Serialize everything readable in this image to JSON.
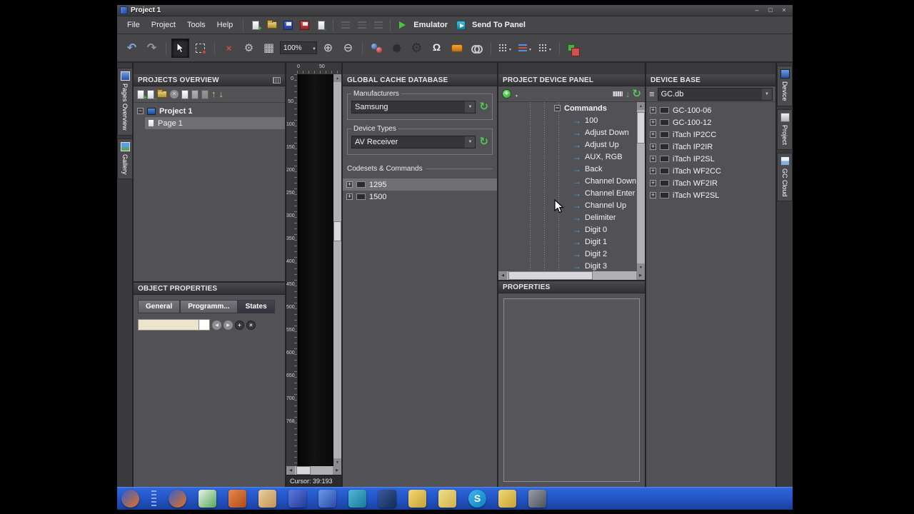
{
  "colors": {
    "taskbar_blue": "#2457c9",
    "panel_bg": "#515156",
    "selection": "#6e6e73",
    "accent_green": "#54c654",
    "command_arrow_blue": "#4aa8e8"
  },
  "titlebar": {
    "title": "Project 1",
    "minimize": "–",
    "maximize": "□",
    "close": "×"
  },
  "menubar": {
    "menus": [
      "File",
      "Project",
      "Tools",
      "Help"
    ],
    "emulator_label": "Emulator",
    "send_to_panel_label": "Send To Panel"
  },
  "toolbar": {
    "zoom": "100%"
  },
  "left_tabs": [
    {
      "label": "Pages Overview"
    },
    {
      "label": "Gallery"
    }
  ],
  "projects_overview": {
    "title": "PROJECTS OVERVIEW",
    "project_name": "Project 1",
    "page_name": "Page 1"
  },
  "object_properties": {
    "title": "OBJECT PROPERTIES",
    "tabs": [
      {
        "label": "General"
      },
      {
        "label": "Programm..."
      },
      {
        "label": "States",
        "selected": true
      }
    ],
    "state_field_value": ""
  },
  "canvas": {
    "hruler": [
      "0",
      "50"
    ],
    "vruler": [
      "0",
      "50",
      "100",
      "150",
      "200",
      "250",
      "300",
      "350",
      "400",
      "450",
      "500",
      "550",
      "600",
      "650",
      "700",
      "768"
    ],
    "status": "Cursor: 39:193"
  },
  "global_cache": {
    "title": "GLOBAL CACHE DATABASE",
    "manufacturers_label": "Manufacturers",
    "manufacturers_value": "Samsung",
    "device_types_label": "Device Types",
    "device_types_value": "AV Receiver",
    "codesets_label": "Codesets & Commands",
    "codesets": [
      {
        "label": "1295",
        "selected": true
      },
      {
        "label": "1500"
      }
    ]
  },
  "project_device_panel": {
    "title": "PROJECT DEVICE PANEL",
    "root_node": "Commands",
    "commands": [
      "100",
      "Adjust Down",
      "Adjust Up",
      "AUX, RGB",
      "Back",
      "Channel Down",
      "Channel Enter",
      "Channel Up",
      "Delimiter",
      "Digit 0",
      "Digit 1",
      "Digit 2",
      "Digit 3"
    ]
  },
  "properties_panel": {
    "title": "PROPERTIES"
  },
  "device_base": {
    "title": "DEVICE BASE",
    "database": "GC.db",
    "devices": [
      "GC-100-06",
      "GC-100-12",
      "iTach IP2CC",
      "iTach IP2IR",
      "iTach IP2SL",
      "iTach WF2CC",
      "iTach WF2IR",
      "iTach WF2SL"
    ]
  },
  "right_tabs": [
    {
      "label": "Device"
    },
    {
      "label": "Project"
    },
    {
      "label": "GC Cloud"
    }
  ],
  "taskbar": {
    "items": [
      {
        "name": "firefox",
        "c1": "#2f5fd0",
        "c2": "#e8701a",
        "cls": "round"
      },
      {
        "name": "grip",
        "cls": "grip"
      },
      {
        "name": "firefox-2",
        "c1": "#2f5fd0",
        "c2": "#e8701a",
        "cls": "round"
      },
      {
        "name": "irule-app",
        "c1": "#eaf2ea",
        "c2": "#56a656"
      },
      {
        "name": "app-orange",
        "c1": "#e88a4a",
        "c2": "#b04818"
      },
      {
        "name": "folder-tan",
        "c1": "#ecd0a0",
        "c2": "#c09050"
      },
      {
        "name": "floppy-blue",
        "c1": "#5a7ae0",
        "c2": "#243a98"
      },
      {
        "name": "windows-blue",
        "c1": "#6a9ae8",
        "c2": "#2a4aa8"
      },
      {
        "name": "app-teal",
        "c1": "#52b8d8",
        "c2": "#187898"
      },
      {
        "name": "app-navy",
        "c1": "#3a5a9a",
        "c2": "#142a58"
      },
      {
        "name": "folder-yellow",
        "c1": "#f0d878",
        "c2": "#c8a030"
      },
      {
        "name": "notes-yellow",
        "c1": "#f0e088",
        "c2": "#d0b048"
      },
      {
        "name": "skype",
        "glyph": "S",
        "c1": "#40b8ec",
        "c2": "#0880c0",
        "cls": "round"
      },
      {
        "name": "folder-yellow-2",
        "c1": "#f0d878",
        "c2": "#c8a030"
      },
      {
        "name": "camera",
        "c1": "#9aa0a8",
        "c2": "#4a5058"
      }
    ]
  }
}
